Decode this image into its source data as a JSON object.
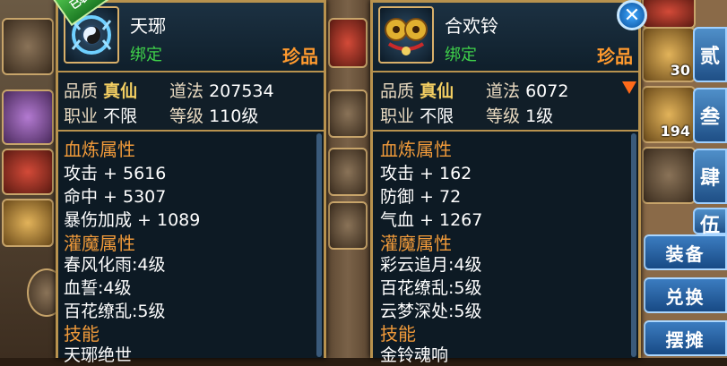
{
  "left_item": {
    "badge": "已装备",
    "name": "天琊",
    "bind": "绑定",
    "rarity": "珍品",
    "quality_label": "品质",
    "quality_value": "真仙",
    "power_label": "道法",
    "power_value": "207534",
    "class_label": "职业",
    "class_value": "不限",
    "level_label": "等级",
    "level_value": "110级",
    "refine_title": "血炼属性",
    "refine_stats": [
      "攻击 + 5616",
      "命中 + 5307",
      "暴伤加成 + 1089"
    ],
    "magic_title": "灌魔属性",
    "magic_stats": [
      "春风化雨:4级",
      "血誓:4级",
      "百花缭乱:5级"
    ],
    "skill_title": "技能",
    "skill_name": "天琊绝世"
  },
  "right_item": {
    "name": "合欢铃",
    "bind": "绑定",
    "rarity": "珍品",
    "quality_label": "品质",
    "quality_value": "真仙",
    "power_label": "道法",
    "power_value": "6072",
    "class_label": "职业",
    "class_value": "不限",
    "level_label": "等级",
    "level_value": "1级",
    "refine_title": "血炼属性",
    "refine_stats": [
      "攻击 + 162",
      "防御 + 72",
      "气血 + 1267"
    ],
    "magic_title": "灌魔属性",
    "magic_stats": [
      "彩云追月:4级",
      "百花缭乱:5级",
      "云梦深处:5级"
    ],
    "skill_title": "技能",
    "skill_name": "金铃魂响"
  },
  "side_tabs": [
    "贰",
    "叁",
    "肆",
    "伍"
  ],
  "side_buttons": [
    "装备",
    "兑换",
    "摆摊"
  ],
  "stack_counts": [
    "30",
    "194"
  ],
  "colors": {
    "panel_border": "#b8924e",
    "bind_green": "#3fd14a",
    "rarity_orange": "#ff9a2e",
    "section_orange": "#f09a3a",
    "quality_gold": "#f4cf62"
  },
  "icons": [
    "close-icon",
    "power-down-arrow-icon",
    "ring-weapon-icon",
    "bell-item-icon"
  ]
}
